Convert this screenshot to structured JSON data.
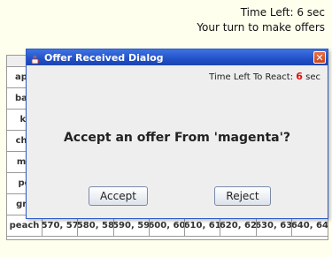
{
  "status": {
    "time_left": "Time Left:  6 sec",
    "turn_message": "Your turn to make offers"
  },
  "table": {
    "row_labels": [
      "app",
      "ban",
      "ki",
      "che",
      "ma",
      "pe",
      "gra"
    ],
    "peach_row": {
      "label": "peach",
      "cells": [
        "570, 57",
        "580, 58",
        "590, 59",
        "600, 60",
        "610, 61",
        "620, 62",
        "630, 63",
        "640, 64"
      ]
    }
  },
  "dialog": {
    "title": "Offer Received Dialog",
    "close_symbol": "✕",
    "react_label": "Time Left To React:",
    "react_seconds": "6",
    "react_unit": "sec",
    "question": "Accept an offer From 'magenta'?",
    "accept_label": "Accept",
    "reject_label": "Reject"
  }
}
